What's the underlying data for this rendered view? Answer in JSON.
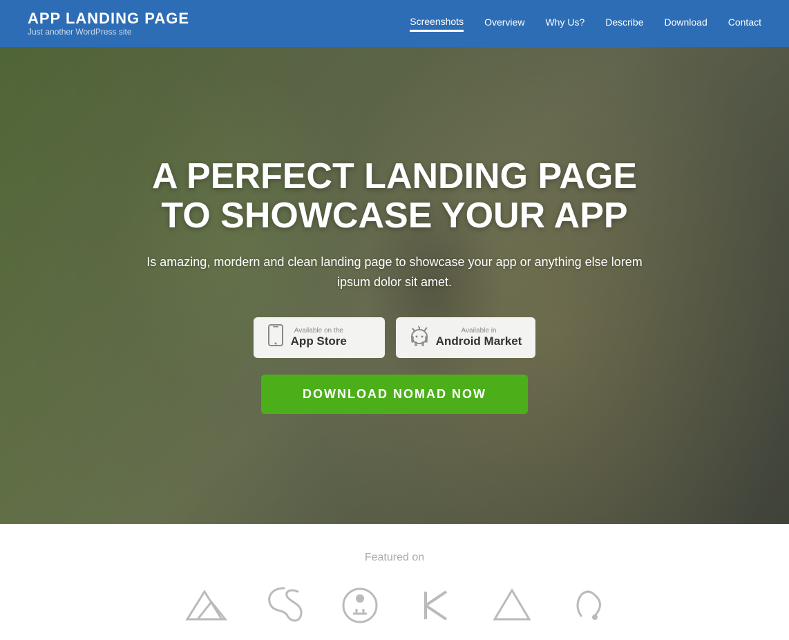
{
  "header": {
    "site_title": "APP LANDING PAGE",
    "site_subtitle": "Just another WordPress site",
    "nav_items": [
      {
        "label": "Screenshots",
        "active": true
      },
      {
        "label": "Overview",
        "active": false
      },
      {
        "label": "Why Us?",
        "active": false
      },
      {
        "label": "Describe",
        "active": false
      },
      {
        "label": "Download",
        "active": false
      },
      {
        "label": "Contact",
        "active": false
      }
    ]
  },
  "hero": {
    "title": "A PERFECT LANDING PAGE TO SHOWCASE YOUR APP",
    "subtitle": "Is amazing, mordern and clean landing page to showcase your app or\nanything else lorem ipsum dolor sit amet.",
    "appstore_label": "Available on the",
    "appstore_name": "App Store",
    "android_label": "Available in",
    "android_name": "Android Market",
    "download_btn": "DOWNLOAD NOMAD NOW"
  },
  "featured": {
    "label": "Featured on",
    "logos_count": 6
  },
  "colors": {
    "header_bg": "#2d6db5",
    "hero_overlay": "rgba(0,0,0,0.45)",
    "download_green": "#4caf1a"
  }
}
